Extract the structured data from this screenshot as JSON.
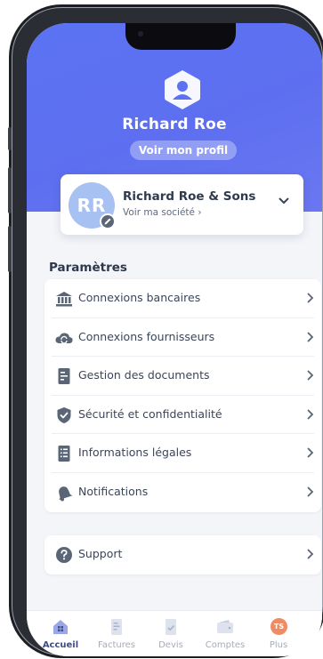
{
  "profile": {
    "name": "Richard Roe",
    "view_profile_label": "Voir mon profil"
  },
  "company": {
    "initials": "RR",
    "name": "Richard Roe & Sons",
    "link_label": "Voir ma société ›"
  },
  "settings": {
    "section_title": "Paramètres",
    "items": [
      {
        "label": "Connexions bancaires",
        "icon": "bank-icon"
      },
      {
        "label": "Connexions fournisseurs",
        "icon": "cloud-sync-icon"
      },
      {
        "label": "Gestion des documents",
        "icon": "document-icon"
      },
      {
        "label": "Sécurité et confidentialité",
        "icon": "shield-check-icon"
      },
      {
        "label": "Informations légales",
        "icon": "list-document-icon"
      },
      {
        "label": "Notifications",
        "icon": "bell-icon"
      }
    ]
  },
  "support": {
    "label": "Support",
    "icon": "help-icon"
  },
  "tabbar": {
    "items": [
      {
        "label": "Accueil",
        "icon": "home-icon",
        "active": true
      },
      {
        "label": "Factures",
        "icon": "invoice-icon",
        "active": false
      },
      {
        "label": "Devis",
        "icon": "quote-icon",
        "active": false
      },
      {
        "label": "Comptes",
        "icon": "wallet-icon",
        "active": false
      },
      {
        "label": "Plus",
        "icon": "avatar-badge",
        "badge": "TS",
        "active": false
      }
    ]
  },
  "colors": {
    "hero": "#5b73f3",
    "accent": "#3f4c86",
    "icon": "#5a6576",
    "badge": "#ef8a63"
  }
}
